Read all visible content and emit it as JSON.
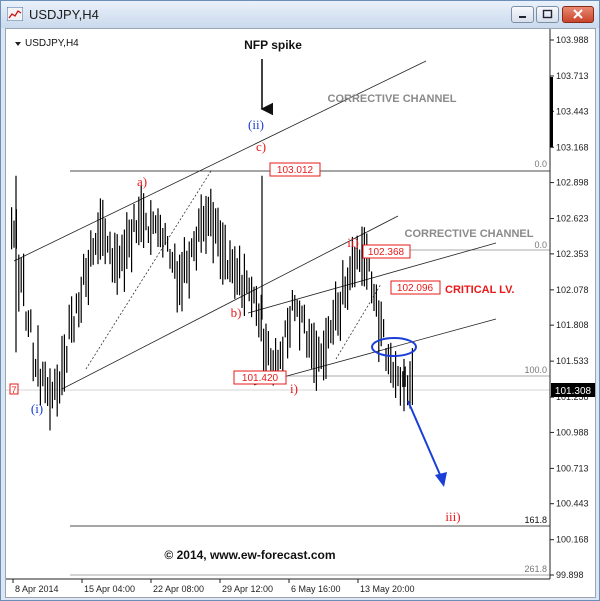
{
  "window": {
    "title": "USDJPY,H4",
    "buttons": [
      "minimize-button",
      "maximize-button",
      "close-button"
    ]
  },
  "chart_data": {
    "type": "candlestick",
    "symbol_label": "USDJPY,H4",
    "y_axis_ticks": [
      "103.988",
      "103.713",
      "103.443",
      "103.168",
      "102.898",
      "102.623",
      "102.353",
      "102.078",
      "101.808",
      "101.533",
      "101.258",
      "100.988",
      "100.713",
      "100.443",
      "100.168",
      "99.898"
    ],
    "x_axis_ticks": [
      "8 Apr 2014",
      "15 Apr 04:00",
      "22 Apr 08:00",
      "29 Apr 12:00",
      "6 May 16:00",
      "13 May 20:00"
    ],
    "current_price": "101.308",
    "price_labels": [
      "103.012",
      "102.368",
      "102.096",
      "101.420"
    ],
    "wave_labels": [
      "(i)",
      "(ii)",
      "a)",
      "b)",
      "c)",
      "i)",
      "ii)",
      "iii)"
    ],
    "fib_labels": [
      "0.0",
      "0.0",
      "100.0",
      "161.8",
      "261.8"
    ],
    "annotations": {
      "nfp": "NFP spike",
      "channel_upper": "CORRECTIVE CHANNEL",
      "channel_lower": "CORRECTIVE CHANNEL",
      "critical": "CRITICAL LV.",
      "copyright": "© 2014, www.ew-forecast.com"
    },
    "series": [
      {
        "values": [
          102.55,
          102.18,
          101.82,
          101.52,
          101.38,
          101.28,
          101.35,
          101.55,
          101.82,
          101.98,
          102.18,
          102.4,
          102.5,
          102.42,
          102.3,
          102.35,
          102.46,
          102.58,
          102.64,
          102.55,
          102.58,
          102.47,
          102.3,
          102.16,
          102.28,
          102.45,
          102.58,
          102.62,
          102.52,
          102.35,
          102.24,
          102.18,
          102.12,
          102.06,
          101.9,
          101.62,
          101.5,
          101.58,
          101.8,
          101.95,
          101.85,
          101.68,
          101.55,
          101.62,
          101.78,
          101.92,
          102.08,
          102.25,
          102.35,
          102.3,
          102.05,
          101.78,
          101.55,
          101.42,
          101.4,
          101.36
        ]
      }
    ],
    "colors": {
      "up": "#000000",
      "down": "#000000",
      "wave_red": "#e8191a",
      "wave_blue": "#1a3fd8",
      "projection": "#1a3fd8"
    }
  }
}
